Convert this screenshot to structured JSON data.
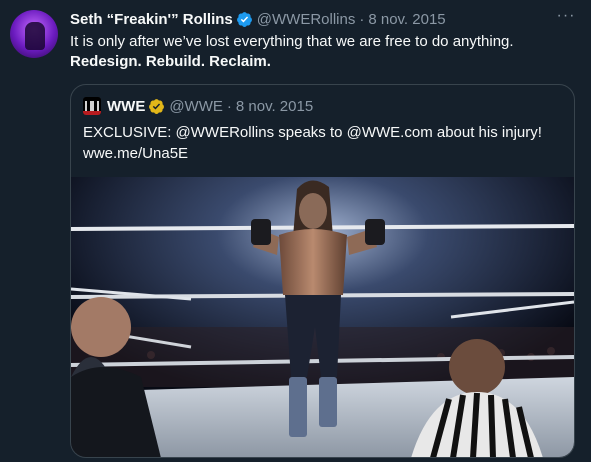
{
  "tweet": {
    "display_name": "Seth “Freakin'” Rollins",
    "handle": "@WWERollins",
    "separator": "·",
    "date": "8 nov. 2015",
    "more_label": "···",
    "text_line1": "It is only after we’ve lost everything that we are free to do anything.",
    "text_line2": "Redesign. Rebuild. Reclaim."
  },
  "quoted_tweet": {
    "display_name": "WWE",
    "handle": "@WWE",
    "separator": "·",
    "date": "8 nov. 2015",
    "text_line1": "EXCLUSIVE: @WWERollins speaks to @WWE.com about his injury!",
    "text_line2": "wwe.me/Una5E"
  },
  "colors": {
    "background": "#15202b",
    "verified_blue": "#1d9bf0",
    "verified_gold": "#e2b719",
    "muted_text": "#8b98a5",
    "border": "#38444d"
  },
  "icons": {
    "verified": "verified-badge-icon",
    "gold_verified": "gold-verified-badge-icon",
    "more": "more-icon",
    "logo": "wwe-logo-icon"
  }
}
